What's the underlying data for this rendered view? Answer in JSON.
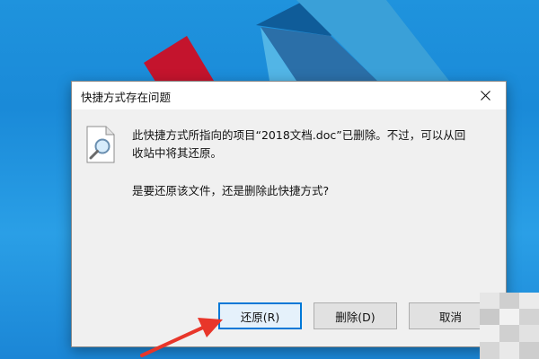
{
  "dialog": {
    "title": "快捷方式存在问题",
    "message_line1": "此快捷方式所指向的项目“2018文档.doc”已删除。不过，可以从回",
    "message_line2": "收站中将其还原。",
    "question": "是要还原该文件，还是删除此快捷方式?",
    "buttons": {
      "restore": "还原(R)",
      "delete": "删除(D)",
      "cancel": "取消"
    }
  },
  "icons": {
    "close": "close-icon",
    "document": "document-search-icon",
    "annotation": "red-arrow-icon"
  },
  "colors": {
    "desktop_blue": "#1f93dd",
    "dialog_bg": "#f0f0f0",
    "focus_border": "#0078d7",
    "arrow_red": "#e8362a"
  }
}
